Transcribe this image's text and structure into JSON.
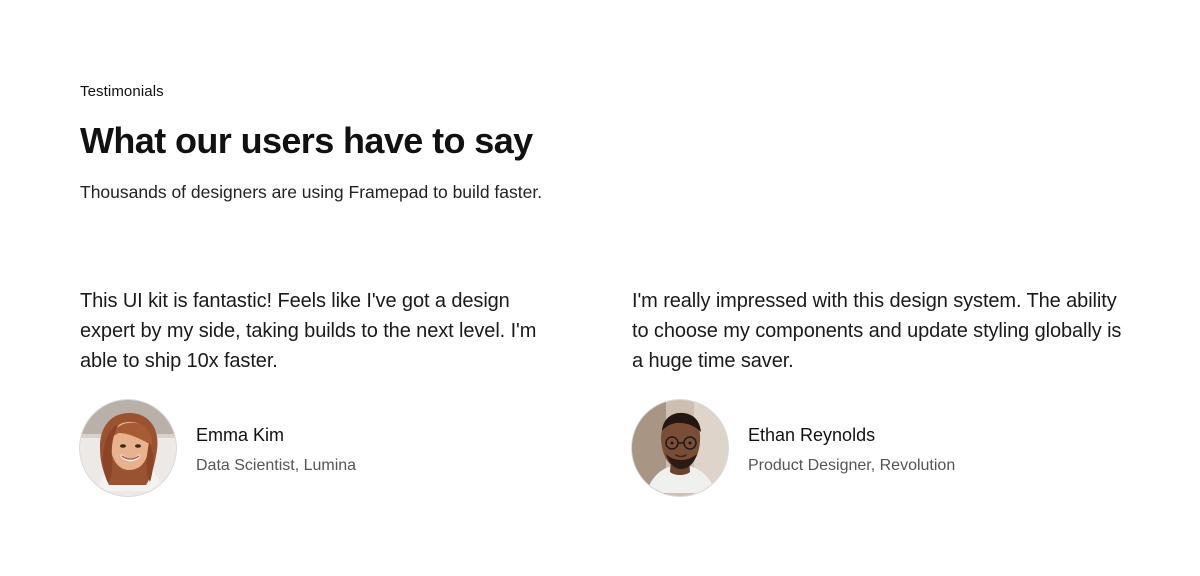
{
  "section": {
    "eyebrow": "Testimonials",
    "heading": "What our users have to say",
    "subheading": "Thousands of designers are using Framepad to build faster."
  },
  "testimonials": [
    {
      "quote": "This UI kit is fantastic! Feels like I've got a design expert by my side, taking builds to the next level. I'm able to ship 10x faster.",
      "name": "Emma Kim",
      "role": "Data Scientist, Lumina",
      "avatar_icon": "woman-portrait"
    },
    {
      "quote": "I'm really impressed with this design system. The ability to choose my components and update styling globally is a huge time saver.",
      "name": "Ethan Reynolds",
      "role": "Product Designer, Revolution",
      "avatar_icon": "man-portrait"
    }
  ],
  "colors": {
    "background": "#ffffff",
    "text": "#111111",
    "muted_text": "#555555",
    "avatar_border": "#d9d9d9"
  }
}
